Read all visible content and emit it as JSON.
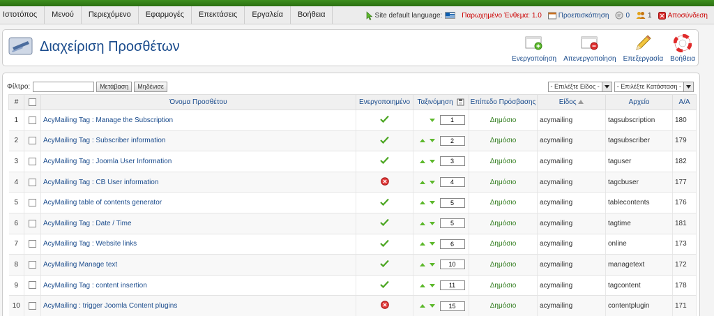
{
  "menu": [
    "Ιστοτόπος",
    "Μενού",
    "Περιεχόμενο",
    "Εφαρμογές",
    "Επεκτάσεις",
    "Εργαλεία",
    "Βοήθεια"
  ],
  "status": {
    "site_lang": "Site default language:",
    "checked_out": "Παρωχημένο Ένθεμα: 1.0",
    "preview": "Προεπισκόπηση",
    "messages": "0",
    "users": "1",
    "logout": "Αποσύνδεση"
  },
  "header": {
    "title": "Διαχείριση Προσθέτων",
    "toolbar": {
      "enable": "Ενεργοποίηση",
      "disable": "Απενεργοποίηση",
      "edit": "Επεξεργασία",
      "help": "Βοήθεια"
    }
  },
  "filter": {
    "label": "Φίλτρο:",
    "value": "",
    "go": "Μετάβαση",
    "reset": "Μηδένισε",
    "type_select": "- Επιλέξτε Είδος -",
    "state_select": "- Επιλέξτε Κατάσταση -"
  },
  "columns": {
    "num": "#",
    "name": "Όνομα Προσθέτου",
    "enabled": "Ενεργοποιημένο",
    "ordering": "Ταξινόμηση",
    "access": "Επίπεδο Πρόσβασης",
    "type": "Είδος",
    "file": "Αρχείο",
    "id": "Α/Α"
  },
  "rows": [
    {
      "n": "1",
      "name": "AcyMailing Tag : Manage the Subscription",
      "enabled": true,
      "order": "1",
      "access": "Δημόσιο",
      "type": "acymailing",
      "file": "tagsubscription",
      "id": "180",
      "up": false,
      "down": true
    },
    {
      "n": "2",
      "name": "AcyMailing Tag : Subscriber information",
      "enabled": true,
      "order": "2",
      "access": "Δημόσιο",
      "type": "acymailing",
      "file": "tagsubscriber",
      "id": "179",
      "up": true,
      "down": true
    },
    {
      "n": "3",
      "name": "AcyMailing Tag : Joomla User Information",
      "enabled": true,
      "order": "3",
      "access": "Δημόσιο",
      "type": "acymailing",
      "file": "taguser",
      "id": "182",
      "up": true,
      "down": true
    },
    {
      "n": "4",
      "name": "AcyMailing Tag : CB User information",
      "enabled": false,
      "order": "4",
      "access": "Δημόσιο",
      "type": "acymailing",
      "file": "tagcbuser",
      "id": "177",
      "up": true,
      "down": true
    },
    {
      "n": "5",
      "name": "AcyMailing table of contents generator",
      "enabled": true,
      "order": "5",
      "access": "Δημόσιο",
      "type": "acymailing",
      "file": "tablecontents",
      "id": "176",
      "up": true,
      "down": true
    },
    {
      "n": "6",
      "name": "AcyMailing Tag : Date / Time",
      "enabled": true,
      "order": "5",
      "access": "Δημόσιο",
      "type": "acymailing",
      "file": "tagtime",
      "id": "181",
      "up": true,
      "down": true
    },
    {
      "n": "7",
      "name": "AcyMailing Tag : Website links",
      "enabled": true,
      "order": "6",
      "access": "Δημόσιο",
      "type": "acymailing",
      "file": "online",
      "id": "173",
      "up": true,
      "down": true
    },
    {
      "n": "8",
      "name": "AcyMailing Manage text",
      "enabled": true,
      "order": "10",
      "access": "Δημόσιο",
      "type": "acymailing",
      "file": "managetext",
      "id": "172",
      "up": true,
      "down": true
    },
    {
      "n": "9",
      "name": "AcyMailing Tag : content insertion",
      "enabled": true,
      "order": "11",
      "access": "Δημόσιο",
      "type": "acymailing",
      "file": "tagcontent",
      "id": "178",
      "up": true,
      "down": true
    },
    {
      "n": "10",
      "name": "AcyMailing : trigger Joomla Content plugins",
      "enabled": false,
      "order": "15",
      "access": "Δημόσιο",
      "type": "acymailing",
      "file": "contentplugin",
      "id": "171",
      "up": true,
      "down": true
    }
  ]
}
